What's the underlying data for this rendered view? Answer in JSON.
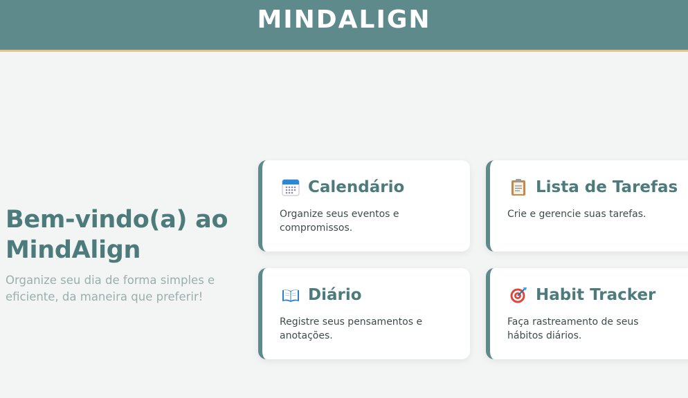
{
  "header": {
    "title": "MINDALIGN"
  },
  "hero": {
    "title": "Bem-vindo(a) ao MindAlign",
    "subtitle": "Organize seu dia de forma simples e eficiente, da maneira que preferir!"
  },
  "cards": [
    {
      "icon": "calendar-icon",
      "title": "Calendário",
      "description": "Organize seus eventos e compromissos."
    },
    {
      "icon": "clipboard-icon",
      "title": "Lista de Tarefas",
      "description": "Crie e gerencie suas tarefas."
    },
    {
      "icon": "book-icon",
      "title": "Diário",
      "description": "Registre seus pensamentos e anotações."
    },
    {
      "icon": "target-icon",
      "title": "Habit Tracker",
      "description": "Faça rastreamento de seus hábitos diários."
    }
  ],
  "colors": {
    "primary": "#5f8a8c",
    "accent": "#e6c489",
    "heading": "#4d7a7a",
    "background": "#f3f5f4"
  }
}
